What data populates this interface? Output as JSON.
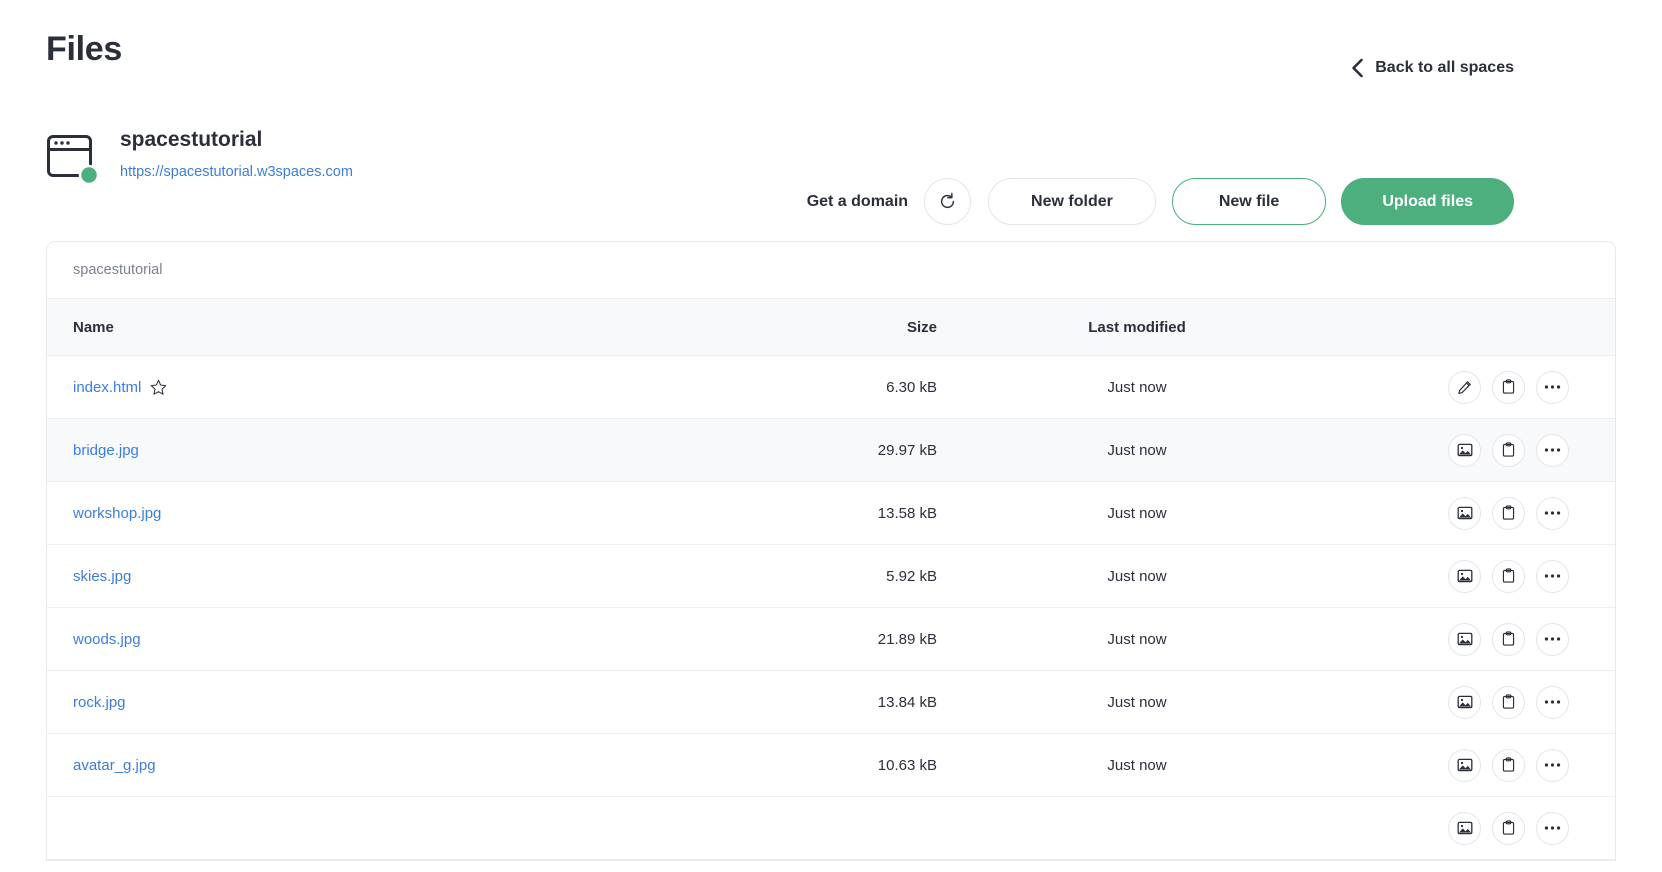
{
  "header": {
    "title": "Files",
    "back_label": "Back to all spaces",
    "back_icon": "chevron-left-icon"
  },
  "space": {
    "icon": "browser-window-icon",
    "status": "online",
    "status_color": "#4caf7d",
    "name": "spacestutorial",
    "url": "https://spacestutorial.w3spaces.com"
  },
  "actions": {
    "get_domain_label": "Get a domain",
    "refresh_icon": "refresh-icon",
    "new_folder_label": "New folder",
    "new_file_label": "New file",
    "upload_label": "Upload files",
    "accent_green": "#4caf7d",
    "link_blue": "#3b7ddd"
  },
  "table": {
    "breadcrumb": "spacestutorial",
    "columns": {
      "name": "Name",
      "size": "Size",
      "modified": "Last modified"
    },
    "rows": [
      {
        "name": "index.html",
        "size": "6.30 kB",
        "modified": "Just now",
        "type_icon": "pencil-icon",
        "starred": true,
        "clipboard_icon": "clipboard-icon",
        "more_icon": "more-horizontal-icon"
      },
      {
        "name": "bridge.jpg",
        "size": "29.97 kB",
        "modified": "Just now",
        "type_icon": "image-icon",
        "starred": false,
        "clipboard_icon": "clipboard-icon",
        "more_icon": "more-horizontal-icon"
      },
      {
        "name": "workshop.jpg",
        "size": "13.58 kB",
        "modified": "Just now",
        "type_icon": "image-icon",
        "starred": false,
        "clipboard_icon": "clipboard-icon",
        "more_icon": "more-horizontal-icon"
      },
      {
        "name": "skies.jpg",
        "size": "5.92 kB",
        "modified": "Just now",
        "type_icon": "image-icon",
        "starred": false,
        "clipboard_icon": "clipboard-icon",
        "more_icon": "more-horizontal-icon"
      },
      {
        "name": "woods.jpg",
        "size": "21.89 kB",
        "modified": "Just now",
        "type_icon": "image-icon",
        "starred": false,
        "clipboard_icon": "clipboard-icon",
        "more_icon": "more-horizontal-icon"
      },
      {
        "name": "rock.jpg",
        "size": "13.84 kB",
        "modified": "Just now",
        "type_icon": "image-icon",
        "starred": false,
        "clipboard_icon": "clipboard-icon",
        "more_icon": "more-horizontal-icon"
      },
      {
        "name": "avatar_g.jpg",
        "size": "10.63 kB",
        "modified": "Just now",
        "type_icon": "image-icon",
        "starred": false,
        "clipboard_icon": "clipboard-icon",
        "more_icon": "more-horizontal-icon"
      },
      {
        "name": "",
        "size": "",
        "modified": "",
        "type_icon": "image-icon",
        "starred": false,
        "clipboard_icon": "clipboard-icon",
        "more_icon": "more-horizontal-icon"
      }
    ]
  }
}
